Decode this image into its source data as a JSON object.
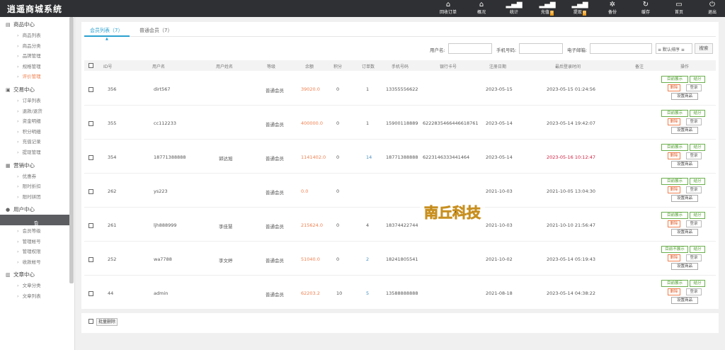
{
  "app": {
    "title": "逍遥商城系统"
  },
  "topnav": [
    {
      "label": "回收订单",
      "icon": "home-icon",
      "glyph": "⌂"
    },
    {
      "label": "概况",
      "icon": "home-icon",
      "glyph": "⌂"
    },
    {
      "label": "统计",
      "icon": "bar-chart-icon",
      "glyph": "▂▄▆",
      "badge": ""
    },
    {
      "label": "充值",
      "icon": "bar-chart-icon",
      "glyph": "▂▄▆",
      "badge": "0"
    },
    {
      "label": "提现",
      "icon": "bar-chart-icon",
      "glyph": "▂▄▆",
      "badge": "0"
    },
    {
      "label": "备份",
      "icon": "gear-icon",
      "glyph": "✲"
    },
    {
      "label": "缓存",
      "icon": "refresh-icon",
      "glyph": "↻"
    },
    {
      "label": "首页",
      "icon": "monitor-icon",
      "glyph": "▭"
    },
    {
      "label": "退出",
      "icon": "power-icon",
      "glyph": "⏻"
    }
  ],
  "sidebar": {
    "sections": [
      {
        "title": "商品中心",
        "icon": "goods-icon",
        "glyph": "▤",
        "items": [
          "商品列表",
          "商品分类",
          "品牌管理",
          "规格管理",
          "评价管理"
        ]
      },
      {
        "title": "交易中心",
        "icon": "trade-icon",
        "glyph": "▣",
        "items": [
          "订单列表",
          "退款/退货",
          "资金明细",
          "积分明细",
          "充值记录",
          "提现管理"
        ]
      },
      {
        "title": "营销中心",
        "icon": "marketing-icon",
        "glyph": "▦",
        "items": [
          "优惠券",
          "限时折扣",
          "限时拼团"
        ]
      },
      {
        "title": "用户中心",
        "icon": "user-icon",
        "glyph": "●",
        "items": [
          "会员列表",
          "会员等级",
          "管理帐号",
          "管理权限",
          "收款帐号"
        ]
      },
      {
        "title": "文章中心",
        "icon": "article-icon",
        "glyph": "▥",
        "items": [
          "文章分类",
          "文章列表"
        ]
      }
    ]
  },
  "tabs": [
    "会员列表（7）",
    "普通会员（7）"
  ],
  "filters": {
    "username_label": "用户名:",
    "phone_label": "手机号码:",
    "email_label": "电子邮箱:",
    "sort_label": "≡ 默认排序 ≡",
    "search_label": "搜索"
  },
  "columns": [
    "ID号",
    "用户名",
    "用户姓名",
    "等级",
    "余额",
    "积分",
    "订单数",
    "手机号码",
    "银行卡号",
    "注册日期",
    "最后登录时间",
    "备注",
    "操作"
  ],
  "rows": [
    {
      "id": "356",
      "username": "dirt567",
      "realname": "",
      "level": "普通会员",
      "balance": "39020.0",
      "points": "0",
      "orders": "1",
      "orders_hl": false,
      "phone": "13355556622",
      "bank": "",
      "reg": "2023-05-15",
      "last": "2023-05-15 01:24:56",
      "last_hl": false,
      "note": "",
      "open": "目前展示"
    },
    {
      "id": "355",
      "username": "cc112233",
      "realname": "",
      "level": "普通会员",
      "balance": "400000.0",
      "points": "0",
      "orders": "1",
      "orders_hl": false,
      "phone": "15900118889",
      "bank": "6222835466446618761",
      "reg": "2023-05-14",
      "last": "2023-05-14 19:42:07",
      "last_hl": false,
      "note": "",
      "open": "目前展示"
    },
    {
      "id": "354",
      "username": "18771388888",
      "realname": "郭达旭",
      "level": "普通会员",
      "balance": "1141402.0",
      "points": "0",
      "orders": "14",
      "orders_hl": true,
      "phone": "18771388888",
      "bank": "6223146333441464",
      "reg": "2023-05-14",
      "last": "2023-05-16 10:12:47",
      "last_hl": true,
      "note": "",
      "open": "目前展示"
    },
    {
      "id": "262",
      "username": "ys223",
      "realname": "",
      "level": "普通会员",
      "balance": "0.0",
      "points": "0",
      "orders": "",
      "orders_hl": false,
      "phone": "",
      "bank": "",
      "reg": "2021-10-03",
      "last": "2021-10-05 13:04:30",
      "last_hl": false,
      "note": "",
      "open": "目前展示"
    },
    {
      "id": "261",
      "username": "ljh888999",
      "realname": "李佳慧",
      "level": "普通会员",
      "balance": "215624.0",
      "points": "0",
      "orders": "4",
      "orders_hl": false,
      "phone": "18374422744",
      "bank": "",
      "reg": "2021-10-03",
      "last": "2021-10-10 21:56:47",
      "last_hl": false,
      "note": "",
      "open": "目前展示"
    },
    {
      "id": "252",
      "username": "wa7788",
      "realname": "李文婷",
      "level": "普通会员",
      "balance": "51040.0",
      "points": "0",
      "orders": "2",
      "orders_hl": true,
      "phone": "18241805541",
      "bank": "",
      "reg": "2021-10-02",
      "last": "2023-05-14 05:19:43",
      "last_hl": false,
      "note": "",
      "open": "目前不展示"
    },
    {
      "id": "44",
      "username": "admin",
      "realname": "",
      "level": "普通会员",
      "balance": "62203.2",
      "points": "10",
      "orders": "5",
      "orders_hl": true,
      "phone": "13588888888",
      "bank": "",
      "reg": "2021-08-18",
      "last": "2023-05-14 04:38:22",
      "last_hl": false,
      "note": "",
      "open": "目前展示"
    }
  ],
  "row_actions": {
    "pay": "结分",
    "delete": "删除",
    "login": "登录",
    "set_goods": "设置商品"
  },
  "footer": {
    "bulk_delete": "批量删除"
  },
  "watermark": {
    "text": "南丘科技"
  }
}
